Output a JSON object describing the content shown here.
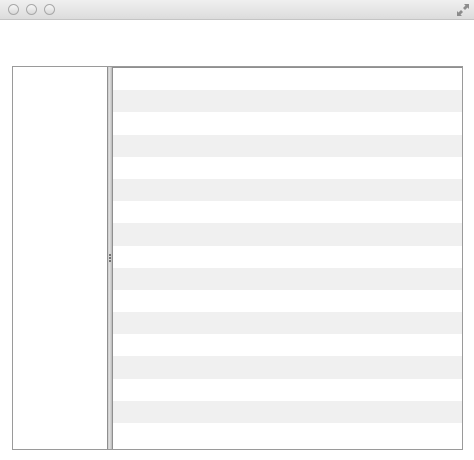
{
  "window": {
    "title": "",
    "buttons": [
      "close",
      "minimize",
      "zoom"
    ],
    "fullscreen_icon": "fullscreen-arrows-icon"
  },
  "sidebar": {
    "items": []
  },
  "table": {
    "row_count": 17,
    "stripe_colors": [
      "#ffffff",
      "#f0f0f0"
    ],
    "rows": []
  }
}
